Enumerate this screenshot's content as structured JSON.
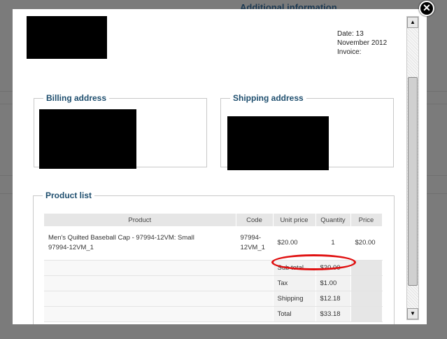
{
  "background": {
    "title": "Additional information"
  },
  "modal": {
    "close_label": "✕"
  },
  "invoice": {
    "date_line1": "Date: 13",
    "date_line2": "November 2012",
    "invoice_label": "Invoice:"
  },
  "billing": {
    "legend": "Billing address"
  },
  "shipping": {
    "legend": "Shipping address"
  },
  "products": {
    "legend": "Product list",
    "headers": [
      "Product",
      "Code",
      "Unit price",
      "Quantity",
      "Price"
    ],
    "items": [
      {
        "product_line1": "Men's Quilted Baseball Cap - 97994-12VM: Small",
        "product_line2": "97994-12VM_1",
        "code_line1": "97994-",
        "code_line2": "12VM_1",
        "unit_price": "$20.00",
        "quantity": "1",
        "price": "$20.00"
      }
    ],
    "totals": [
      {
        "label": "Sub total",
        "value": "$20.00"
      },
      {
        "label": "Tax",
        "value": "$1.00"
      },
      {
        "label": "Shipping",
        "value": "$12.18"
      },
      {
        "label": "Total",
        "value": "$33.18"
      }
    ]
  },
  "annotation": {
    "color": "#e01010"
  },
  "scrollbar": {
    "up_icon": "▲",
    "down_icon": "▼"
  }
}
